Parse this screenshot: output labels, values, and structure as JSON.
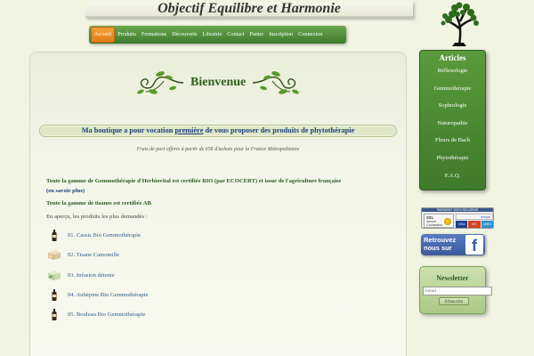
{
  "site": {
    "title": "Objectif Equilibre et Harmonie"
  },
  "nav": {
    "items": [
      "Accueil",
      "Produits",
      "Formations",
      "Découverte",
      "Librairie",
      "Contact",
      "Panier",
      "Inscription",
      "Connexion"
    ],
    "active": "Accueil"
  },
  "main": {
    "welcome": "Bienvenue",
    "banner_before": "Ma boutique a pour vocation ",
    "banner_emph": "première",
    "banner_after": " de vous proposer des produits de phytothérapie",
    "shipping": "Frais de port offerts à partir de 65€ d'achats pour la France Métropolitaine",
    "gamme1": "Toute la gamme de Gemmothérapie d'Herbiovital est certifiée BIO (par ECOCERT) et issue de l'agriculture française",
    "gamme1_more": "(en savoir plus)",
    "gamme2": "Toute la gamme de tisanes est certifiée AB",
    "apercu": "En aperçu, les produits les plus demandés :",
    "products": [
      "01. Cassis Bio Gemmothérapie",
      "02. Tisane Camomille",
      "03. Infusion détente",
      "04. Aubépine Bio Gemmothérapie",
      "05. Bouleau Bio Gemmothérapie"
    ]
  },
  "sidebar": {
    "articles_title": "Articles",
    "articles": [
      "Réflexologie",
      "Gemmothérapie",
      "Sophrologie",
      "Naturopathie",
      "Fleurs de Bach",
      "Phytothérapie",
      "F.A.Q."
    ]
  },
  "secure_badge": {
    "header": "PAIEMENT 100% SÉCURISÉ",
    "ssl_title": "SSL",
    "ssl_line1": "Secure",
    "ssl_line2": "Connection",
    "powered": "stripe",
    "cards": [
      "VISA",
      "MC",
      "AMEX"
    ]
  },
  "facebook": {
    "line1": "Retrouvez",
    "line2": "nous sur",
    "logo": "f"
  },
  "newsletter": {
    "title": "Newsletter",
    "email_placeholder": "email",
    "subscribe_label": "S'inscrire"
  },
  "colors": {
    "accent_green": "#3f7a2e",
    "active_orange": "#f08a1e",
    "link_blue": "#1f3f7f",
    "facebook_blue": "#3b5998"
  }
}
